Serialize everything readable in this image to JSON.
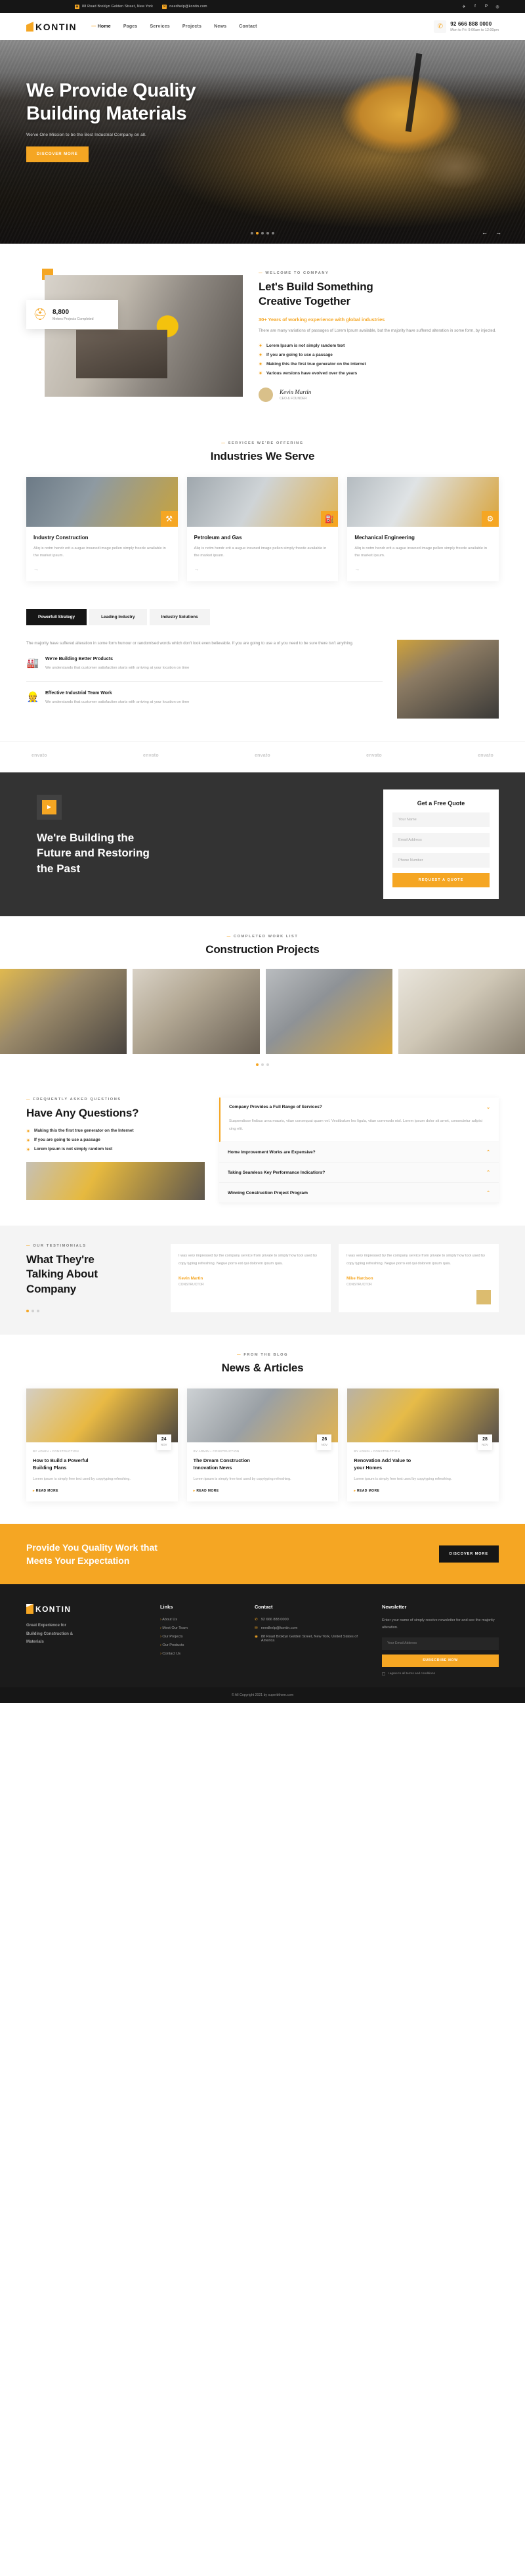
{
  "topbar": {
    "address": "88 Road Broklyn Golden Street, New York",
    "email": "needhelp@kontin.com",
    "socials": [
      "twitter-icon",
      "facebook-icon",
      "pinterest-icon",
      "instagram-icon"
    ]
  },
  "header": {
    "brand": "KONTIN",
    "nav": [
      {
        "label": "Home",
        "active": true
      },
      {
        "label": "Pages",
        "active": false
      },
      {
        "label": "Services",
        "active": false
      },
      {
        "label": "Projects",
        "active": false
      },
      {
        "label": "News",
        "active": false
      },
      {
        "label": "Contact",
        "active": false
      }
    ],
    "phone": "92 666 888 0000",
    "hours": "Mon to Fri: 9:00am to 12:00pm"
  },
  "hero": {
    "title_line1": "We Provide Quality",
    "title_line2": "Building Materials",
    "subtitle": "We've One Mission to be the Best Industrial Company on all.",
    "cta": "DISCOVER MORE",
    "dots": 5,
    "active_dot": 1,
    "prev": "←",
    "next": "→"
  },
  "about": {
    "badge_number": "8,800",
    "badge_label": "Meters Projects Completed",
    "eyebrow": "WELCOME TO COMPANY",
    "title_line1": "Let's Build Something",
    "title_line2": "Creative Together",
    "lead": "30+ Years of working experience with global industries",
    "paragraph": "There are many variations of passages of Lorem Ipsum available, but the majority have suffered alteration in some form, by injected.",
    "ticks": [
      "Lorem Ipsum is not simply random text",
      "If you are going to use a passage",
      "Making this the first true generator on the internet",
      "Various versions have evolved over the years"
    ],
    "signature_name": "Kevin Martin",
    "signature_role": "CEO & FOUNDER"
  },
  "industries": {
    "eyebrow": "SERVICES WE'RE OFFERING",
    "title": "Industries We Serve",
    "cards": [
      {
        "title": "Industry Construction",
        "text": "Aliq is notm hendr erit a augue insuned image pellen simply freede available in the market ipsum.",
        "arrow": "→",
        "badge": "⚒"
      },
      {
        "title": "Petroleum and Gas",
        "text": "Aliq is notm hendr erit a augue insuned image pellen simply freede available in the market ipsum.",
        "arrow": "→",
        "badge": "⛽"
      },
      {
        "title": "Mechanical Engineering",
        "text": "Aliq is notm hendr erit a augue insuned image pellen simply freede available in the market ipsum.",
        "arrow": "→",
        "badge": "⚙"
      }
    ]
  },
  "why": {
    "tabs": [
      {
        "label": "Powerfull Strategy",
        "active": true
      },
      {
        "label": "Leading Industry",
        "active": false
      },
      {
        "label": "Industry Solutions",
        "active": false
      }
    ],
    "paragraph": "The majority have suffered alteration in some form humour or randomised words which don't look even believable. If you are going to use a of you need to be sure there isn't anything.",
    "features": [
      {
        "title": "We're Building Better Products",
        "text": "We understands that customer satisfaction starts with arriving at your location on time",
        "icon": "factory-icon"
      },
      {
        "title": "Effective Industrial Team Work",
        "text": "We understands that customer satisfaction starts with arriving at your location on time",
        "icon": "team-icon"
      }
    ]
  },
  "brands": [
    "envato",
    "envato",
    "envato",
    "envato",
    "envato"
  ],
  "cta": {
    "play": "▶",
    "heading_line1": "We're Building the",
    "heading_line2": "Future and Restoring",
    "heading_line3": "the Past",
    "form_title": "Get a Free Quote",
    "fields": [
      {
        "placeholder": "Your Name",
        "value": ""
      },
      {
        "placeholder": "Email Address",
        "value": ""
      },
      {
        "placeholder": "Phone Number",
        "value": ""
      }
    ],
    "submit": "REQUEST A QUOTE"
  },
  "projects": {
    "eyebrow": "COMPLETED WORK LIST",
    "title": "Construction Projects",
    "dots": 3,
    "active_dot": 1
  },
  "faq": {
    "eyebrow": "FREQUENTLY ASKED QUESTIONS",
    "title": "Have Any Questions?",
    "ticks": [
      "Making this the first true generator on the Internet",
      "If you are going to use a passage",
      "Lorem Ipsum is not simply random text"
    ],
    "items": [
      {
        "question": "Company Provides a Full Range of Services?",
        "answer": "Suspendisse finibus urna mauris, vitae consequat quam vel. Vestibulum leo ligula, vitae commodo nisl. Lorem ipsum dolor sit amet, consectetur adipisi cing elit.",
        "open": true,
        "chevron": "⌄"
      },
      {
        "question": "Home Improvement Works are Expensive?",
        "answer": "",
        "open": false,
        "chevron": "⌃"
      },
      {
        "question": "Taking Seamless Key Performance Indicatiors?",
        "answer": "",
        "open": false,
        "chevron": "⌃"
      },
      {
        "question": "Winning Construction Project Program",
        "answer": "",
        "open": false,
        "chevron": "⌃"
      }
    ]
  },
  "testimonials": {
    "eyebrow": "OUR TESTIMONIALS",
    "title_line1": "What They're",
    "title_line2": "Talking About",
    "title_line3": "Company",
    "cards": [
      {
        "text": "I was very impressed by the company service from private to simply how tool used by copy typing refreshing. Negue porro est qui dolorem ipsum quia.",
        "name": "Kevin Martin",
        "role": "CONSTRUCTOR"
      },
      {
        "text": "I was very impressed by the company service from private to simply how tool used by copy typing refreshing. Negue porro est qui dolorem ipsum quia.",
        "name": "Mike Hardson",
        "role": "CONSTRUCTOR"
      }
    ],
    "dots": 3,
    "active_dot": 1
  },
  "news": {
    "eyebrow": "FROM THE BLOG",
    "title": "News & Articles",
    "cards": [
      {
        "day": "24",
        "month": "NOV",
        "meta": "BY ADMIN  •  CONSTRUCTION",
        "title_line1": "How to Build a Powerful",
        "title_line2": "Building Plans",
        "text": "Lorem ipsum is simply free text used by copytyping refreshing.",
        "more": "READ MORE"
      },
      {
        "day": "26",
        "month": "NOV",
        "meta": "BY ADMIN  •  CONSTRUCTION",
        "title_line1": "The Dream Construction",
        "title_line2": "Innovation News",
        "text": "Lorem ipsum is simply free text used by copytyping refreshing.",
        "more": "READ MORE"
      },
      {
        "day": "28",
        "month": "NOV",
        "meta": "BY ADMIN  •  CONSTRUCTION",
        "title_line1": "Renovation Add Value to",
        "title_line2": "your Homes",
        "text": "Lorem ipsum is simply free text used by copytyping refreshing.",
        "more": "READ MORE"
      }
    ]
  },
  "ycta": {
    "line1": "Provide You Quality Work that",
    "line2": "Meets Your Expectation",
    "button": "DISCOVER MORE"
  },
  "footer": {
    "brand": "KONTIN",
    "desc_line1": "Great Experience for",
    "desc_line2": "Building Construction &",
    "desc_line3": "Materials",
    "links_title": "Links",
    "links": [
      "About Us",
      "Meet Our Team",
      "Our Projects",
      "Our Products",
      "Contact Us"
    ],
    "contact_title": "Contact",
    "contact": [
      {
        "icon": "phone-icon",
        "text": "92 666 888 0000"
      },
      {
        "icon": "mail-icon",
        "text": "needhelp@kontin.com"
      },
      {
        "icon": "pin-icon",
        "text": "88 Road Broklyn Golden Street,\nNew York, United States of America"
      }
    ],
    "newsletter_title": "Newsletter",
    "newsletter_text": "Enter your name of simply receive newsletter for and see the majority alteration.",
    "newsletter_placeholder": "Your Email Address",
    "newsletter_button": "SUBSCRIBE NOW",
    "consent": "I agree to all terms and conditions",
    "copyright": "© All Copyright 2021 by superbthem.com"
  }
}
